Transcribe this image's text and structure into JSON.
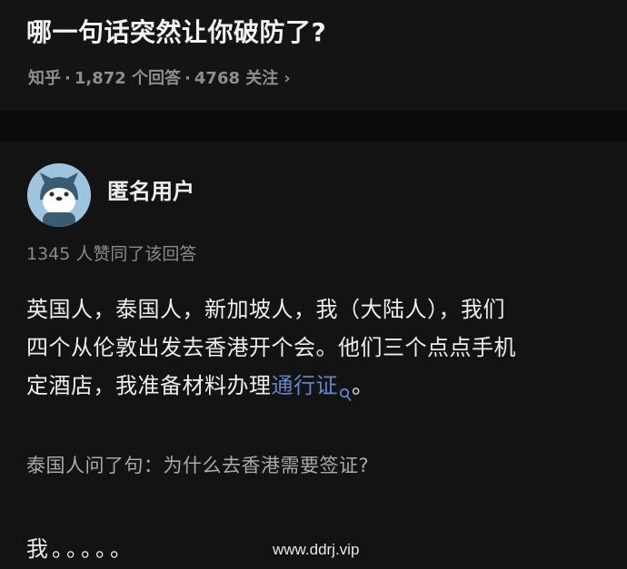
{
  "question": {
    "title": "哪一句话突然让你破防了?",
    "meta_source": "知乎",
    "meta_answers": "1,872 个回答",
    "meta_followers": "4768 关注",
    "separator": "·",
    "chevron": "›"
  },
  "answer": {
    "author_name": "匿名用户",
    "avatar_icon": "anonymous-user-avatar",
    "like_text": "1345 人赞同了该回答",
    "body_lines": [
      "英国人，泰国人，新加坡人，我（大陆人），我们",
      "四个从伦敦出发去香港开个会。他们三个点点手机"
    ],
    "line3_prefix": "定酒店，我准备材料办理",
    "link_text": "通行证",
    "line3_suffix": "。",
    "quote": "泰国人问了句：为什么去香港需要签证?",
    "final": "我。。。。。"
  },
  "watermark": "www.ddrj.vip",
  "colors": {
    "background": "#111111",
    "title": "#f2f2f2",
    "meta": "#8e8e8e",
    "link": "#5f86c8",
    "avatar_bg": "#9fc4de"
  }
}
